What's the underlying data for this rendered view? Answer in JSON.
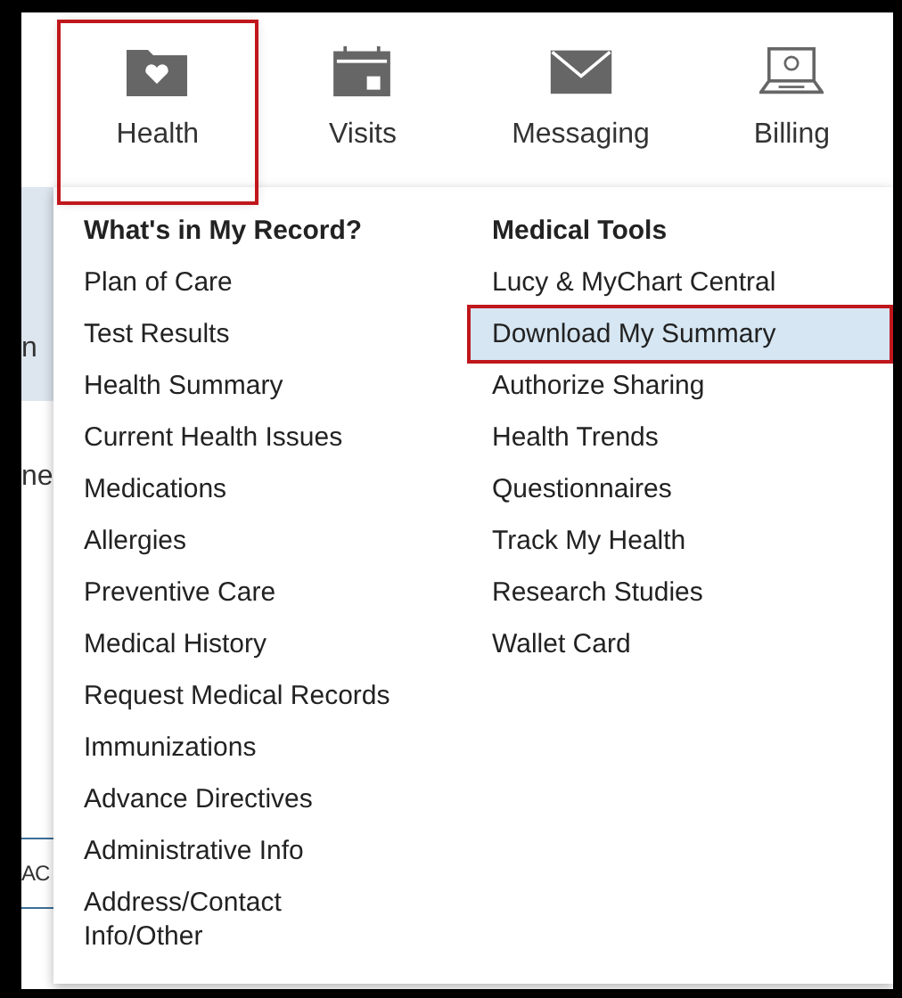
{
  "nav": [
    {
      "label": "Health",
      "kind": "folder-heart",
      "selected": true,
      "highlighted": true
    },
    {
      "label": "Visits",
      "kind": "calendar",
      "selected": false,
      "highlighted": false
    },
    {
      "label": "Messaging",
      "kind": "envelope",
      "selected": false,
      "highlighted": false
    },
    {
      "label": "Billing",
      "kind": "laptop",
      "selected": false,
      "highlighted": false
    }
  ],
  "background_fragments": [
    {
      "text": "n",
      "kind": "text"
    },
    {
      "text": "ne",
      "kind": "text"
    },
    {
      "text": "AC",
      "kind": "button"
    }
  ],
  "menu": {
    "columns": [
      {
        "heading": "What's in My Record?",
        "items": [
          {
            "label": "Plan of Care",
            "selected": false,
            "highlighted": false
          },
          {
            "label": "Test Results",
            "selected": false,
            "highlighted": false
          },
          {
            "label": "Health Summary",
            "selected": false,
            "highlighted": false
          },
          {
            "label": "Current Health Issues",
            "selected": false,
            "highlighted": false
          },
          {
            "label": "Medications",
            "selected": false,
            "highlighted": false
          },
          {
            "label": "Allergies",
            "selected": false,
            "highlighted": false
          },
          {
            "label": "Preventive Care",
            "selected": false,
            "highlighted": false
          },
          {
            "label": "Medical History",
            "selected": false,
            "highlighted": false
          },
          {
            "label": "Request Medical Records",
            "selected": false,
            "highlighted": false
          },
          {
            "label": "Immunizations",
            "selected": false,
            "highlighted": false
          },
          {
            "label": "Advance Directives",
            "selected": false,
            "highlighted": false
          },
          {
            "label": "Administrative Info",
            "selected": false,
            "highlighted": false
          },
          {
            "label": "Address/Contact\nInfo/Other",
            "selected": false,
            "highlighted": false
          }
        ]
      },
      {
        "heading": "Medical Tools",
        "items": [
          {
            "label": "Lucy & MyChart Central",
            "selected": false,
            "highlighted": false
          },
          {
            "label": "Download My Summary",
            "selected": true,
            "highlighted": true
          },
          {
            "label": "Authorize Sharing",
            "selected": false,
            "highlighted": false
          },
          {
            "label": "Health Trends",
            "selected": false,
            "highlighted": false
          },
          {
            "label": "Questionnaires",
            "selected": false,
            "highlighted": false
          },
          {
            "label": "Track My Health",
            "selected": false,
            "highlighted": false
          },
          {
            "label": "Research Studies",
            "selected": false,
            "highlighted": false
          },
          {
            "label": "Wallet Card",
            "selected": false,
            "highlighted": false
          }
        ]
      }
    ]
  }
}
